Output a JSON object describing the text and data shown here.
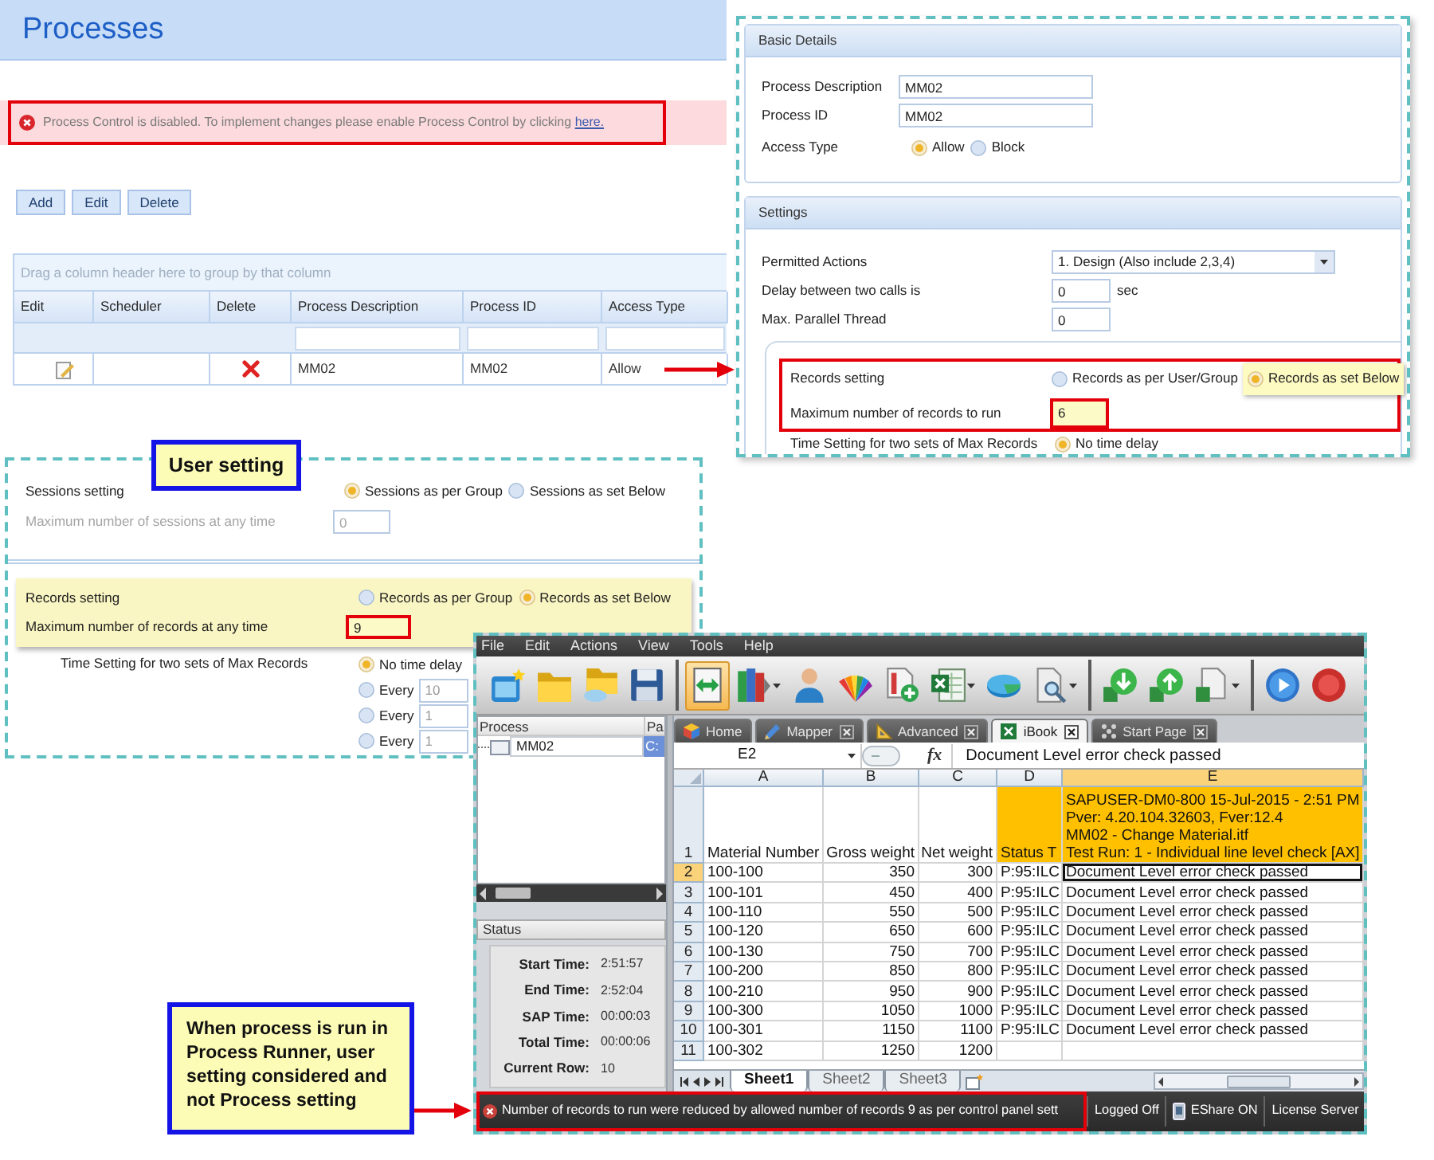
{
  "processes_page": {
    "title": "Processes",
    "alert": {
      "text": "Process Control is disabled. To implement changes please enable Process Control by clicking",
      "link": "here.",
      "highlighted": true
    },
    "buttons": [
      "Add",
      "Edit",
      "Delete"
    ],
    "grid": {
      "group_hint": "Drag a column header here to group by that column",
      "columns": [
        {
          "label": "Edit",
          "filter": false
        },
        {
          "label": "Scheduler",
          "filter": false
        },
        {
          "label": "Delete",
          "filter": false
        },
        {
          "label": "Process Description",
          "filter": true
        },
        {
          "label": "Process ID",
          "filter": true
        },
        {
          "label": "Access Type",
          "filter": true
        }
      ],
      "rows": [
        {
          "cells": [
            {
              "kind": "edit"
            },
            {
              "kind": "empty"
            },
            {
              "kind": "delete"
            },
            {
              "kind": "text",
              "text": "MM02"
            },
            {
              "kind": "text",
              "text": "MM02"
            },
            {
              "kind": "text",
              "text": "Allow"
            }
          ]
        }
      ]
    }
  },
  "process_details": {
    "basic_details": {
      "title": "Basic Details",
      "fields": [
        {
          "label": "Process Description",
          "value": "MM02"
        },
        {
          "label": "Process ID",
          "value": "MM02"
        }
      ],
      "access_type": {
        "label": "Access Type",
        "options": [
          {
            "label": "Allow",
            "selected": true
          },
          {
            "label": "Block",
            "selected": false
          }
        ]
      }
    },
    "settings": {
      "title": "Settings",
      "permitted_actions": {
        "label": "Permitted Actions",
        "value": "1. Design (Also include 2,3,4)"
      },
      "delay": {
        "label": "Delay between two calls is",
        "value": "0",
        "unit": "sec"
      },
      "max_parallel_thread": {
        "label": "Max. Parallel Thread",
        "value": "0"
      },
      "records": {
        "highlighted": true,
        "label": "Records setting",
        "options": [
          {
            "label": "Records as per User/Group",
            "selected": false,
            "hovered": false
          },
          {
            "label": "Records as set Below",
            "selected": true,
            "hovered": true
          }
        ],
        "max_records": {
          "label": "Maximum number of records to run",
          "value": "6",
          "highlighted": true
        }
      },
      "time_setting": {
        "label": "Time Setting for two sets of Max Records",
        "options": [
          {
            "label": "No time delay",
            "selected": true
          }
        ]
      }
    }
  },
  "user_settings": {
    "callout": "User setting",
    "sessions": {
      "label": "Sessions setting",
      "options": [
        {
          "label": "Sessions as per Group",
          "selected": true
        },
        {
          "label": "Sessions as set Below",
          "selected": false
        }
      ],
      "max_sessions": {
        "label": "Maximum number of sessions at any time",
        "value": "0",
        "disabled": true
      }
    },
    "records": {
      "highlighted": true,
      "label": "Records setting",
      "options": [
        {
          "label": "Records as per Group",
          "selected": false
        },
        {
          "label": "Records as set Below",
          "selected": true
        }
      ],
      "max_records": {
        "label": "Maximum number of records at any time",
        "value": "9",
        "highlighted": true
      }
    },
    "time_setting": {
      "label": "Time Setting for two sets of Max Records",
      "options": [
        {
          "kind": "plain",
          "label": "No time delay",
          "selected": true
        },
        {
          "kind": "interval",
          "label": "Every",
          "value": "10",
          "selected": false
        },
        {
          "kind": "interval",
          "label": "Every",
          "value": "1",
          "selected": false
        },
        {
          "kind": "interval",
          "label": "Every",
          "value": "1",
          "selected": false
        }
      ]
    }
  },
  "runner": {
    "menu": [
      "File",
      "Edit",
      "Actions",
      "View",
      "Tools",
      "Help"
    ],
    "toolbar": [
      {
        "items": [
          {
            "selected": false,
            "menu": false
          },
          {
            "selected": false,
            "menu": false
          },
          {
            "selected": false,
            "menu": false
          },
          {
            "selected": false,
            "menu": false
          }
        ]
      },
      {
        "items": [
          {
            "selected": true,
            "menu": false
          },
          {
            "selected": false,
            "menu": true
          },
          {
            "selected": false,
            "menu": false
          },
          {
            "selected": false,
            "menu": false
          },
          {
            "selected": false,
            "menu": false
          },
          {
            "selected": false,
            "menu": true
          },
          {
            "selected": false,
            "menu": false
          },
          {
            "selected": false,
            "menu": true
          }
        ]
      },
      {
        "items": [
          {
            "selected": false,
            "menu": false
          },
          {
            "selected": false,
            "menu": false
          },
          {
            "selected": false,
            "menu": true
          }
        ]
      },
      {
        "items": [
          {
            "selected": false,
            "menu": false
          },
          {
            "selected": false,
            "menu": false
          }
        ]
      }
    ],
    "process_pane": {
      "columns": [
        "Process",
        "Pa"
      ],
      "items": [
        {
          "label": "MM02",
          "column_2": "C:",
          "selected": true
        }
      ]
    },
    "status_pane": {
      "title": "Status",
      "fields": [
        {
          "label": "Start Time:",
          "value": "2:51:57"
        },
        {
          "label": "End Time:",
          "value": "2:52:04"
        },
        {
          "label": "SAP Time:",
          "value": "00:00:03"
        },
        {
          "label": "Total Time:",
          "value": "00:00:06"
        },
        {
          "label": "Current Row:",
          "value": "10"
        }
      ]
    },
    "tabs": [
      {
        "label": "Home",
        "closable": false,
        "selected": false
      },
      {
        "label": "Mapper",
        "closable": true,
        "selected": false
      },
      {
        "label": "Advanced",
        "closable": true,
        "selected": false
      },
      {
        "label": "iBook",
        "closable": true,
        "selected": true
      },
      {
        "label": "Start Page",
        "closable": true,
        "selected": false
      }
    ],
    "formula_bar": {
      "cell": "E2",
      "function_symbol": "fx",
      "value": "Document Level error check passed"
    },
    "sheet": {
      "columns": [
        {
          "label": "A",
          "numeric": false,
          "selected": false
        },
        {
          "label": "B",
          "numeric": true,
          "selected": false
        },
        {
          "label": "C",
          "numeric": true,
          "selected": false
        },
        {
          "label": "D",
          "numeric": false,
          "selected": false
        },
        {
          "label": "E",
          "numeric": false,
          "selected": true
        }
      ],
      "rows": [
        {
          "number": "1",
          "kind": "header",
          "selected": false,
          "cells": [
            {
              "lines": [
                "Material Number"
              ],
              "highlighted": false
            },
            {
              "lines": [
                "Gross weight"
              ],
              "highlighted": false
            },
            {
              "lines": [
                "Net weight"
              ],
              "highlighted": false
            },
            {
              "lines": [
                "Status T"
              ],
              "highlighted": true
            },
            {
              "lines": [
                "SAPUSER-DM0-800 15-Jul-2015 - 2:51 PM",
                "Pver: 4.20.104.32603, Fver:12.4",
                "MM02 - Change Material.itf",
                "Test Run: 1 - Individual line level check [AX]"
              ],
              "highlighted": true
            }
          ]
        },
        {
          "number": "2",
          "kind": "data",
          "selected": true,
          "cells": [
            "100-100",
            "350",
            "300",
            "P:95:ILC",
            "Document Level error check passed"
          ]
        },
        {
          "number": "3",
          "kind": "data",
          "selected": false,
          "cells": [
            "100-101",
            "450",
            "400",
            "P:95:ILC",
            "Document Level error check passed"
          ]
        },
        {
          "number": "4",
          "kind": "data",
          "selected": false,
          "cells": [
            "100-110",
            "550",
            "500",
            "P:95:ILC",
            "Document Level error check passed"
          ]
        },
        {
          "number": "5",
          "kind": "data",
          "selected": false,
          "cells": [
            "100-120",
            "650",
            "600",
            "P:95:ILC",
            "Document Level error check passed"
          ]
        },
        {
          "number": "6",
          "kind": "data",
          "selected": false,
          "cells": [
            "100-130",
            "750",
            "700",
            "P:95:ILC",
            "Document Level error check passed"
          ]
        },
        {
          "number": "7",
          "kind": "data",
          "selected": false,
          "cells": [
            "100-200",
            "850",
            "800",
            "P:95:ILC",
            "Document Level error check passed"
          ]
        },
        {
          "number": "8",
          "kind": "data",
          "selected": false,
          "cells": [
            "100-210",
            "950",
            "900",
            "P:95:ILC",
            "Document Level error check passed"
          ]
        },
        {
          "number": "9",
          "kind": "data",
          "selected": false,
          "cells": [
            "100-300",
            "1050",
            "1000",
            "P:95:ILC",
            "Document Level error check passed"
          ]
        },
        {
          "number": "10",
          "kind": "data",
          "selected": false,
          "cells": [
            "100-301",
            "1150",
            "1100",
            "P:95:ILC",
            "Document Level error check passed"
          ]
        },
        {
          "number": "11",
          "kind": "data",
          "selected": false,
          "cells": [
            "100-302",
            "1250",
            "1200"
          ]
        }
      ]
    },
    "sheet_tabs": [
      {
        "label": "Sheet1",
        "selected": true
      },
      {
        "label": "Sheet2",
        "selected": false
      },
      {
        "label": "Sheet3",
        "selected": false
      }
    ],
    "status_bar": {
      "message": {
        "text": "Number of records to run were reduced by allowed number of records 9 as per control panel sett",
        "highlighted": true
      },
      "items": [
        {
          "kind": "text",
          "label": "Logged Off"
        },
        {
          "kind": "share",
          "label": "EShare ON"
        },
        {
          "kind": "text",
          "label": "License Server"
        }
      ]
    }
  },
  "note": "When process is run in Process Runner, user setting considered and not Process setting"
}
